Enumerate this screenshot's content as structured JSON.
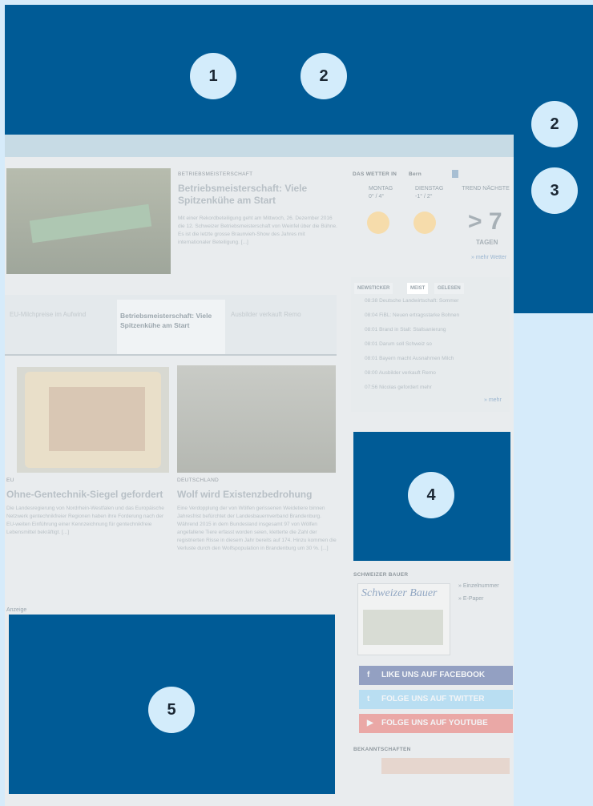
{
  "markers": [
    "1",
    "2",
    "2",
    "3",
    "4",
    "5"
  ],
  "main_article": {
    "kicker": "BETRIEBSMEISTERSCHAFT",
    "title": "Betriebsmeisterschaft: Viele Spitzenkühe am Start",
    "body": "Mit einer Rekordbeteiligung geht am Mittwoch, 26. Dezember 2016 die 12. Schweizer Betriebsmeisterschaft von Weinfel über die Bühne. Es ist die letzte grosse Braunvieh-Show des Jahres mit internationaler Beteiligung. [...]"
  },
  "slider": {
    "items": [
      {
        "title": "EU-Milchpreise im Aufwind"
      },
      {
        "title": "Betriebsmeisterschaft: Viele Spitzenkühe am Start"
      },
      {
        "title": "Ausbilder verkauft Remo"
      }
    ]
  },
  "card_left": {
    "kicker": "EU",
    "title": "Ohne-Gentechnik-Siegel gefordert",
    "body": "Die Landesregierung von Nordrhein-Westfalen und das Europäische Netzwerk gentechnikfreier Regionen haben ihre Forderung nach der EU-weiten Einführung einer Kennzeichnung für gentechnikfreie Lebensmittel bekräftigt. [...]"
  },
  "card_right": {
    "kicker": "DEUTSCHLAND",
    "title": "Wolf wird Existenzbedrohung",
    "body": "Eine Verdopplung der von Wölfen gerissenen Weidetiere binnen Jahresfrist befürchtet der Landesbauernverband Brandenburg. Während 2015 in dem Bundesland insgesamt 97 von Wölfen angefallene Tiere erfasst worden seien, kletterte die Zahl der registrierten Risse in diesem Jahr bereits auf 174. Hinzu kommen die Verluste durch den Wolfspopulation in Brandenburg um 30 %. [...]"
  },
  "weather": {
    "header": "DAS WETTER IN",
    "location": "Bern",
    "days": [
      {
        "name": "MONTAG",
        "temps": "0° / 4°"
      },
      {
        "name": "DIENSTAG",
        "temps": "-1° / 2°"
      }
    ],
    "outlook_label": "TREND NÄCHSTE",
    "outlook_value": "> 7",
    "outlook_unit": "TAGEN",
    "more_link": "» mehr Wetter"
  },
  "ticker": {
    "tabs": [
      "NEWSTICKER",
      "MEIST",
      "GELESEN"
    ],
    "items": [
      "08:38 Deutsche Landwirtschaft: Sommer",
      "08:04 FiBL: Neuen ertragsstarke Bohnen",
      "08:01 Brand in Stall: Stallsanierung",
      "08:01 Darum soll Schweiz so",
      "08:01 Bayern macht Ausnahmen Milch",
      "08:00 Ausbilder verkauft Remo",
      "07:56 Nicolas gefordert mehr"
    ],
    "more": "» mehr"
  },
  "magazine": {
    "header": "SCHWEIZER BAUER",
    "logo": "Schweizer Bauer",
    "links": [
      "» Einzelnummer",
      "» E-Paper"
    ]
  },
  "social": [
    {
      "label": "LIKE UNS AUF FACEBOOK",
      "icon": "f",
      "color": "#6e7fae"
    },
    {
      "label": "FOLGE UNS AUF TWITTER",
      "icon": "t",
      "color": "#9ad0ef"
    },
    {
      "label": "FOLGE UNS AUF YOUTUBE",
      "icon": "▶",
      "color": "#e98d8a"
    }
  ],
  "bekannt": "BEKANNTSCHAFTEN",
  "ads": "Anzeige"
}
